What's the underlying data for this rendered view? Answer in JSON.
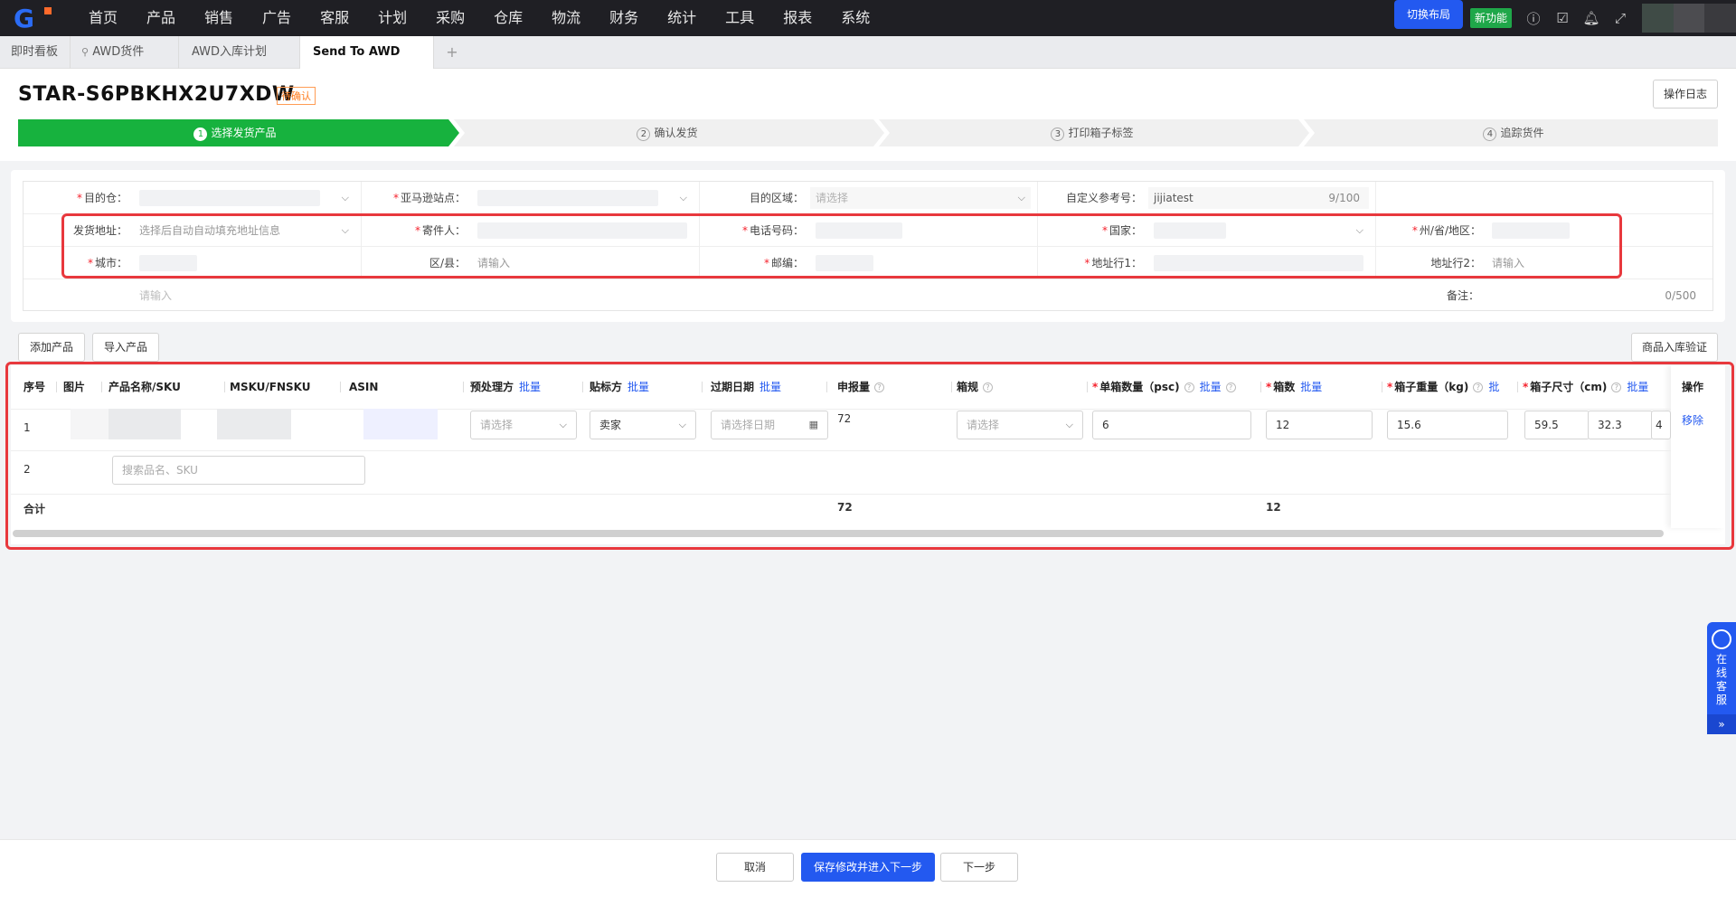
{
  "nav": {
    "menu": [
      "首页",
      "产品",
      "销售",
      "广告",
      "客服",
      "计划",
      "采购",
      "仓库",
      "物流",
      "财务",
      "统计",
      "工具",
      "报表",
      "系统"
    ],
    "switch_layout": "切换布局",
    "new_feature": "新功能",
    "icons": [
      "info-icon",
      "todo-icon",
      "bell-icon",
      "fullscreen-icon"
    ]
  },
  "tabs": [
    {
      "label": "即时看板"
    },
    {
      "label": "AWD货件",
      "icon": "pin-icon"
    },
    {
      "label": "AWD入库计划"
    },
    {
      "label": "Send To AWD"
    }
  ],
  "header": {
    "title": "STAR-S6PBKHX2U7XDW",
    "status": "待确认",
    "oplog": "操作日志"
  },
  "steps": [
    {
      "num": "1",
      "label": "选择发货产品"
    },
    {
      "num": "2",
      "label": "确认发货"
    },
    {
      "num": "3",
      "label": "打印箱子标签"
    },
    {
      "num": "4",
      "label": "追踪货件"
    }
  ],
  "form": {
    "dest_warehouse": "目的仓：",
    "amazon_site": "亚马逊站点：",
    "dest_region": "目的区域：",
    "dest_region_ph": "请选择",
    "custom_ref": "自定义参考号：",
    "custom_ref_value": "jijiatest",
    "custom_ref_count": "9/100",
    "ship_addr": "发货地址：",
    "ship_addr_ph": "选择后自动自动填充地址信息",
    "sender": "寄件人：",
    "phone": "电话号码：",
    "country": "国家：",
    "state": "州/省/地区：",
    "city": "城市：",
    "district": "区/县：",
    "district_ph": "请输入",
    "zip": "邮编：",
    "addr1": "地址行1：",
    "addr2": "地址行2：",
    "addr2_ph": "请输入",
    "remark": "备注：",
    "remark_ph": "请输入",
    "remark_count": "0/500"
  },
  "buttons": {
    "add_product": "添加产品",
    "import_product": "导入产品",
    "verify": "商品入库验证"
  },
  "table": {
    "headers": {
      "seq": "序号",
      "image": "图片",
      "name": "产品名称/SKU",
      "msku": "MSKU/FNSKU",
      "asin": "ASIN",
      "prep": "预处理方",
      "label": "贴标方",
      "expiry": "过期日期",
      "declared": "申报量",
      "box_spec": "箱规",
      "per_box": "单箱数量（psc)",
      "boxes": "箱数",
      "weight": "箱子重量（kg)",
      "size": "箱子尺寸（cm)",
      "action": "操作"
    },
    "batch": "批量",
    "batch_short": "批",
    "rows": [
      {
        "seq": "1",
        "prep_ph": "请选择",
        "label_value": "卖家",
        "expiry_ph": "请选择日期",
        "declared": "72",
        "box_spec_ph": "请选择",
        "per_box": "6",
        "boxes": "12",
        "weight": "15.6",
        "size_l": "59.5",
        "size_w": "32.3",
        "size_h": "4",
        "action": "移除"
      },
      {
        "seq": "2",
        "search_ph": "搜索品名、SKU"
      }
    ],
    "total_label": "合计",
    "total_declared": "72",
    "total_boxes": "12"
  },
  "footer": {
    "cancel": "取消",
    "save_next": "保存修改并进入下一步",
    "next": "下一步"
  },
  "service": {
    "text": "在线客服",
    "arrow": "»"
  },
  "colors": {
    "accent": "#2359f0",
    "step_active": "#17b23e",
    "highlight": "#e8383d",
    "nav_bg": "#1f1f24"
  }
}
